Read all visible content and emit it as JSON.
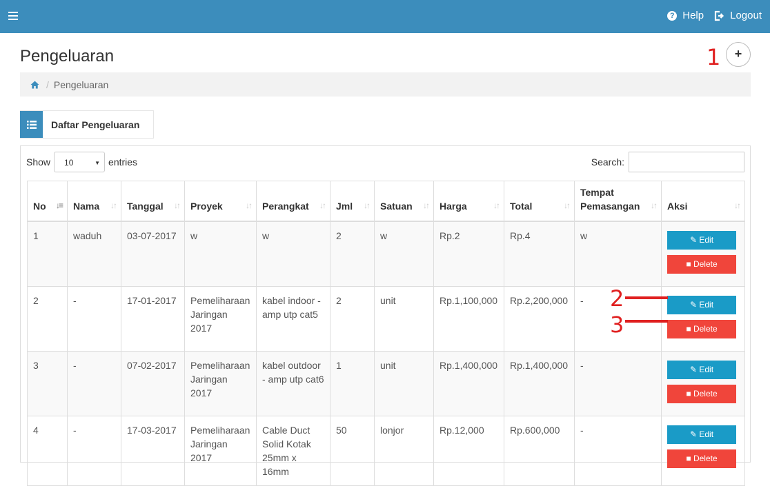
{
  "topbar": {
    "help_label": "Help",
    "logout_label": "Logout",
    "color": "#3c8dbc"
  },
  "page": {
    "title": "Pengeluaran",
    "add_label": "+"
  },
  "breadcrumb": {
    "current": "Pengeluaran"
  },
  "panel": {
    "title": "Daftar Pengeluaran"
  },
  "table_controls": {
    "show_label": "Show",
    "entries_value": "10",
    "entries_label": "entries",
    "search_label": "Search:"
  },
  "annotations": {
    "m1": "1",
    "m2": "2",
    "m3": "3"
  },
  "table": {
    "columns": [
      "No",
      "Nama",
      "Tanggal",
      "Proyek",
      "Perangkat",
      "Jml",
      "Satuan",
      "Harga",
      "Total",
      "Tempat Pemasangan",
      "Aksi"
    ],
    "edit_label": "Edit",
    "delete_label": "Delete",
    "rows": [
      {
        "no": "1",
        "nama": "waduh",
        "tanggal": "03-07-2017",
        "proyek": "w",
        "perangkat": "w",
        "jml": "2",
        "satuan": "w",
        "harga": "Rp.2",
        "total": "Rp.4",
        "tempat": "w"
      },
      {
        "no": "2",
        "nama": "-",
        "tanggal": "17-01-2017",
        "proyek": "Pemeliharaan Jaringan 2017",
        "perangkat": "kabel indoor - amp utp cat5",
        "jml": "2",
        "satuan": "unit",
        "harga": "Rp.1,100,000",
        "total": "Rp.2,200,000",
        "tempat": "-"
      },
      {
        "no": "3",
        "nama": "-",
        "tanggal": "07-02-2017",
        "proyek": "Pemeliharaan Jaringan 2017",
        "perangkat": "kabel outdoor - amp utp cat6",
        "jml": "1",
        "satuan": "unit",
        "harga": "Rp.1,400,000",
        "total": "Rp.1,400,000",
        "tempat": "-"
      },
      {
        "no": "4",
        "nama": "-",
        "tanggal": "17-03-2017",
        "proyek": "Pemeliharaan Jaringan 2017",
        "perangkat": "Cable Duct Solid Kotak 25mm x 16mm",
        "jml": "50",
        "satuan": "lonjor",
        "harga": "Rp.12,000",
        "total": "Rp.600,000",
        "tempat": "-"
      }
    ]
  }
}
